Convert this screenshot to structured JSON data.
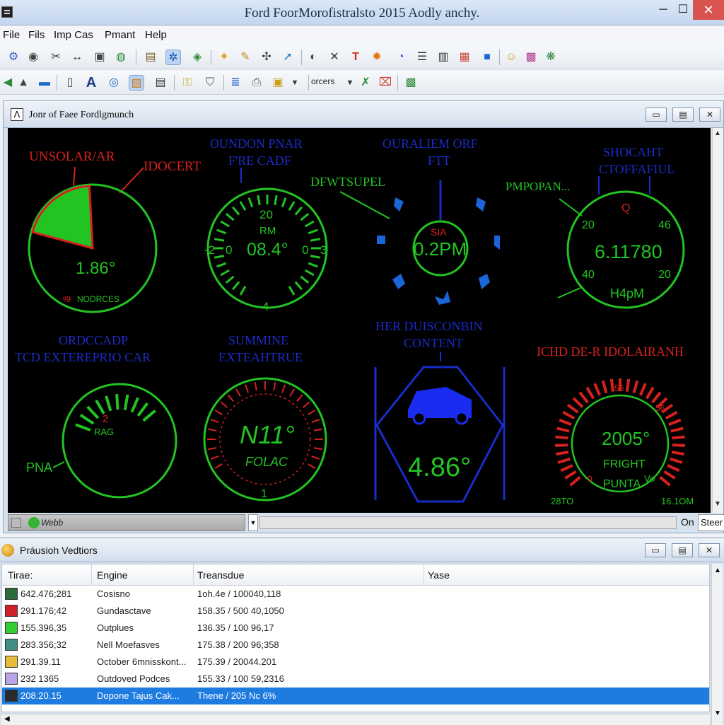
{
  "window": {
    "title": "Ford FoorMorofistralsto 2015 Aodly anchy.",
    "min_glyph": "─",
    "max_glyph": "☐",
    "close_glyph": "✕"
  },
  "menu": [
    "File",
    "Fils",
    "Imp Cas",
    "Pmant",
    "Help"
  ],
  "toolbar": {
    "dropdown_label": "orcers"
  },
  "panel": {
    "title": "Jonr of Faee Fordlgmunch",
    "icon_glyph": "Ʌ"
  },
  "gauges": {
    "g1": {
      "title": "UNSOLAR/AR",
      "callout": "IDOCERT",
      "value": "1.86°",
      "footer": "NODRCES",
      "footer_prefix": "ᵍ9",
      "fill_fraction": 0.2
    },
    "g2": {
      "title_line1": "OUNDON PNAR",
      "title_line2": "F'RE CADF",
      "value": "08.4°",
      "unit": "RM",
      "top": "20",
      "left": "-2",
      "left2": "0",
      "right": "0",
      "right2": "3",
      "bottom": "4"
    },
    "g3": {
      "title_line1": "OURALIEM ORF",
      "title_line2": "FTT",
      "callout": "DFWTSUPEL",
      "value": "0.2PM",
      "label": "SIA"
    },
    "g4": {
      "title_line1": "SHOCAHT",
      "title_line2": "CTOFFAFIUL",
      "callout": "PMPOPAN...",
      "value": "6.11780",
      "unit": "H4pM",
      "tl": "20",
      "tr": "46",
      "top": "Q",
      "bl": "40",
      "br": "20"
    },
    "g5": {
      "title_line1": "ORDCCADP",
      "title_line2": "TCD EXTEREPRIO CAR",
      "value": "2",
      "unit": "RAG",
      "side": "PNA"
    },
    "g6": {
      "title_line1": "SUMMINE",
      "title_line2": "EXTEAHTRUE",
      "value": "N11°",
      "unit": "FOLAC",
      "bottom": "1"
    },
    "g7": {
      "title_line1": "HER DUISCONBIN",
      "title_line2": "CONTENT",
      "value": "4.86°"
    },
    "g8": {
      "title": "ICHD DE-R IDOLAIRANH",
      "value": "2005°",
      "line1": "FRIGHT",
      "line2": "PUNTA",
      "top": "56",
      "tr": "56",
      "bl": "0",
      "br": "Vo",
      "foot_left": "28TO",
      "foot_right": "16.1OM"
    }
  },
  "statusbar": {
    "left_label": "Webb",
    "on_label": "On",
    "steer_label": "Steer"
  },
  "panel2": {
    "title": "Práusioh Vedtiors",
    "columns": [
      "Tirae:",
      "Engine",
      "Treansdue",
      "Yase"
    ],
    "rows": [
      {
        "color": "#2e6b3a",
        "time": "642.476;281",
        "engine": "Cosisno",
        "trans": "1oh.4e / 100040,118"
      },
      {
        "color": "#d0202a",
        "time": "291.176;42",
        "engine": "Gundasctave",
        "trans": "158.35 / 500 40,1050"
      },
      {
        "color": "#33cc33",
        "time": "155.396,35",
        "engine": "Outplues",
        "trans": "136.35 / 100 96,17"
      },
      {
        "color": "#3f8f86",
        "time": "283.356;32",
        "engine": "Nell Moefasves",
        "trans": "175.38 / 200 96;358"
      },
      {
        "color": "#e8b93a",
        "time": "291.39.11",
        "engine": "October 6mnisskont...",
        "trans": "175.39 / 20044.201"
      },
      {
        "color": "#b9a6e6",
        "time": "232 1365",
        "engine": "Outdoved Podces",
        "trans": "155.33 / 100 59,2316"
      },
      {
        "color": "#2a2a2a",
        "time": "208.20.15",
        "engine": "Dopone Tajus Cak...",
        "trans": "Thene / 205 Nc 6%",
        "selected": true
      }
    ]
  },
  "colors": {
    "gauge_green": "#22c422",
    "gauge_blue": "#1a2cc8",
    "gauge_red": "#d8201e",
    "selection": "#1e7be0"
  }
}
